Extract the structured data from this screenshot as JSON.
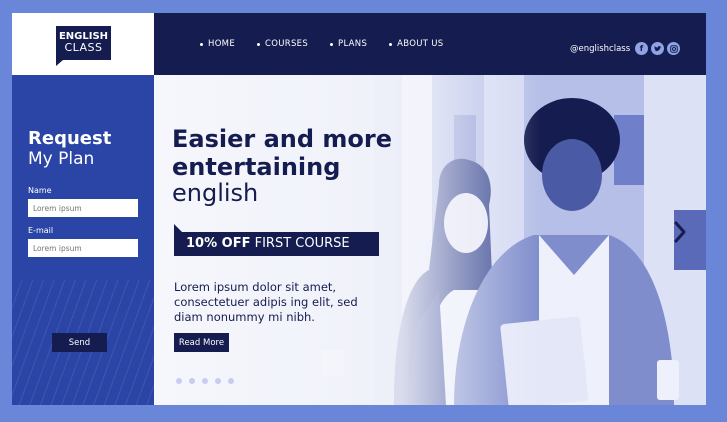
{
  "logo": {
    "line1": "ENGLISH",
    "line2": "CLASS"
  },
  "nav": {
    "items": [
      "HOME",
      "COURSES",
      "PLANS",
      "ABOUT US"
    ]
  },
  "social": {
    "handle": "@englishclass",
    "icons": [
      "facebook-icon",
      "twitter-icon",
      "instagram-icon"
    ]
  },
  "form": {
    "title_line1": "Request",
    "title_line2": "My Plan",
    "name_label": "Name",
    "name_placeholder": "Lorem ipsum",
    "email_label": "E-mail",
    "email_placeholder": "Lorem ipsum",
    "send_label": "Send"
  },
  "hero": {
    "headline_line1": "Easier and more",
    "headline_line2": "entertaining",
    "headline_line3": "english",
    "offer_bold": "10% OFF",
    "offer_rest": " FIRST COURSE",
    "paragraph": "Lorem ipsum dolor sit amet, consectetuer adipis ing elit, sed diam nonummy mi nibh.",
    "read_more_label": "Read More",
    "slide_count": 5,
    "active_slide": 1
  },
  "colors": {
    "navy": "#151c4f",
    "royal_blue": "#2a45a6",
    "background": "#6a86d9"
  }
}
